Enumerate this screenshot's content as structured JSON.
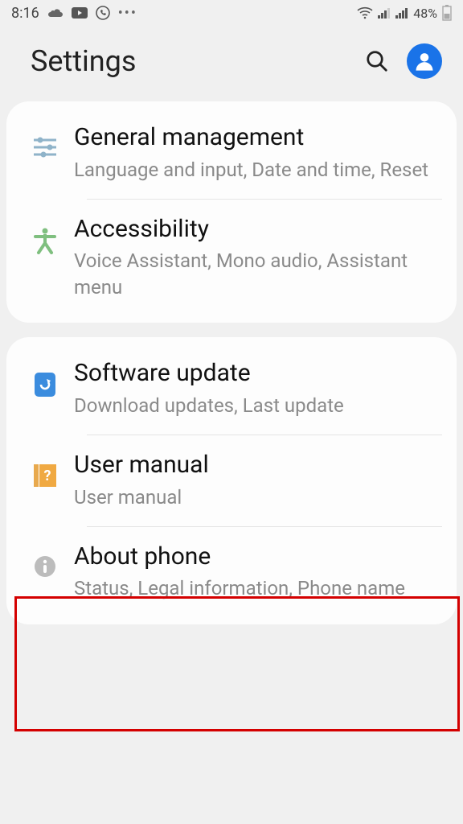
{
  "status": {
    "time": "8:16",
    "battery": "48%"
  },
  "header": {
    "title": "Settings"
  },
  "groups": [
    {
      "items": [
        {
          "icon": "sliders",
          "title": "General management",
          "subtitle": "Language and input, Date and time, Reset"
        },
        {
          "icon": "accessibility",
          "title": "Accessibility",
          "subtitle": "Voice Assistant, Mono audio, Assistant menu"
        }
      ]
    },
    {
      "items": [
        {
          "icon": "refresh",
          "title": "Software update",
          "subtitle": "Download updates, Last update"
        },
        {
          "icon": "manual",
          "title": "User manual",
          "subtitle": "User manual"
        },
        {
          "icon": "info",
          "title": "About phone",
          "subtitle": "Status, Legal information, Phone name"
        }
      ]
    }
  ]
}
